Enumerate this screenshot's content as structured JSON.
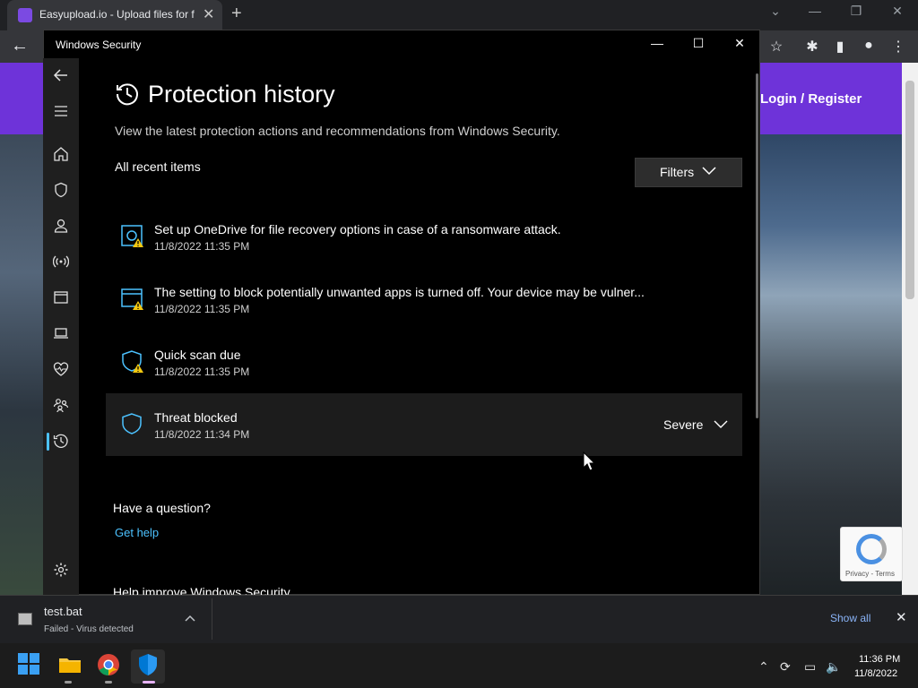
{
  "browser": {
    "tab_title": "Easyupload.io - Upload files for f",
    "tab_close": "✕",
    "new_tab": "+",
    "back": "←"
  },
  "webpage": {
    "login_link": "Login / Register",
    "recaptcha_text": "Privacy - Terms"
  },
  "winsec": {
    "window_title": "Windows Security",
    "page_title": "Protection history",
    "subtitle": "View the latest protection actions and recommendations from Windows Security.",
    "recent_label": "All recent items",
    "filters_label": "Filters",
    "items": [
      {
        "title": "Set up OneDrive for file recovery options in case of a ransomware attack.",
        "date": "11/8/2022 11:35 PM",
        "icon": "onedrive-warning-icon"
      },
      {
        "title": "The setting to block potentially unwanted apps is turned off. Your device may be vulner...",
        "date": "11/8/2022 11:35 PM",
        "icon": "app-browser-warning-icon"
      },
      {
        "title": "Quick scan due",
        "date": "11/8/2022 11:35 PM",
        "icon": "shield-warning-icon"
      },
      {
        "title": "Threat blocked",
        "date": "11/8/2022 11:34 PM",
        "icon": "shield-icon",
        "severity": "Severe"
      }
    ],
    "question": "Have a question?",
    "get_help": "Get help",
    "improve": "Help improve Windows Security"
  },
  "downloads": {
    "filename": "test.bat",
    "status": "Failed - Virus detected",
    "show_all": "Show all"
  },
  "taskbar": {
    "time": "11:36 PM",
    "date": "11/8/2022"
  },
  "colors": {
    "accent": "#4cc2ff",
    "warning": "#f2c811",
    "page_header": "#6e33d9"
  }
}
